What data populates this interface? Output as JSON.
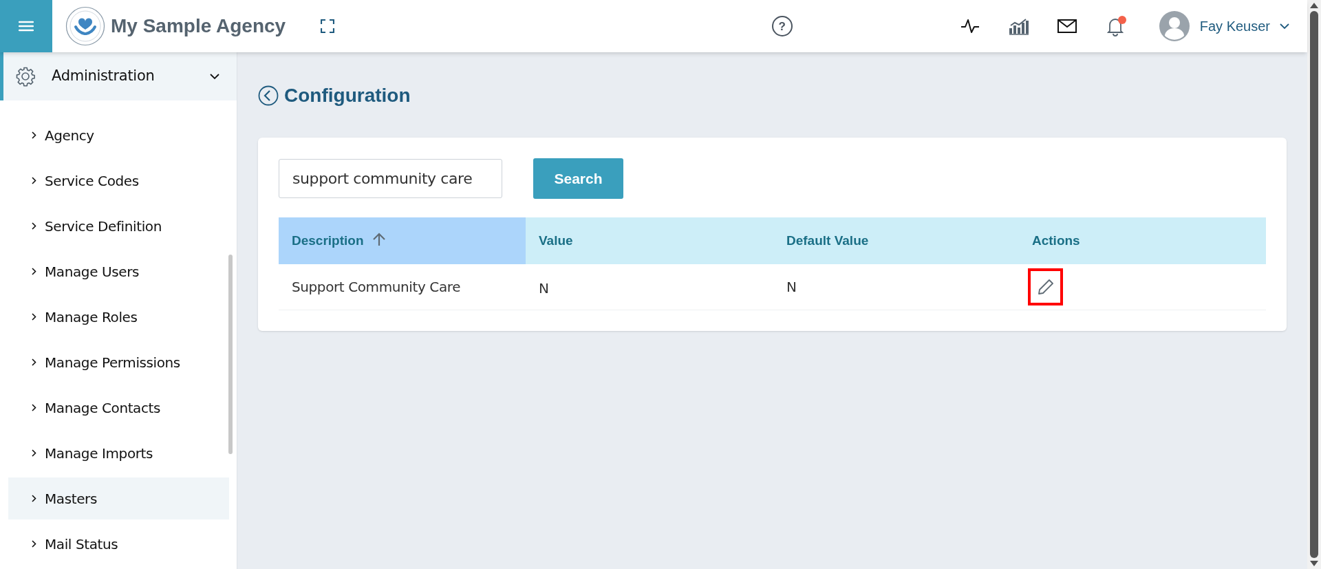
{
  "header": {
    "app_title": "My Sample Agency",
    "help_icon": "?",
    "notifications_unread": true,
    "user_name": "Fay Keuser"
  },
  "sidebar": {
    "section": {
      "label": "Administration",
      "expanded": true
    },
    "items": [
      {
        "label": "Agency",
        "selected": false
      },
      {
        "label": "Service Codes",
        "selected": false
      },
      {
        "label": "Service Definition",
        "selected": false
      },
      {
        "label": "Manage Users",
        "selected": false
      },
      {
        "label": "Manage Roles",
        "selected": false
      },
      {
        "label": "Manage Permissions",
        "selected": false
      },
      {
        "label": "Manage Contacts",
        "selected": false
      },
      {
        "label": "Manage Imports",
        "selected": false
      },
      {
        "label": "Masters",
        "selected": true
      },
      {
        "label": "Mail Status",
        "selected": false
      }
    ]
  },
  "page": {
    "title": "Configuration",
    "search": {
      "value": "support community care",
      "button": "Search"
    },
    "table": {
      "columns": [
        {
          "label": "Description",
          "sorted": true
        },
        {
          "label": "Value",
          "sorted": false
        },
        {
          "label": "Default Value",
          "sorted": false
        },
        {
          "label": "Actions",
          "sorted": false
        }
      ],
      "rows": [
        {
          "description": "Support Community Care",
          "value": "N",
          "default_value": "N"
        }
      ]
    }
  }
}
